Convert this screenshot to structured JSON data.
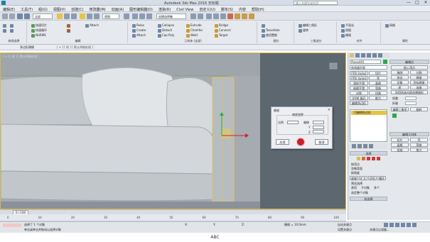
{
  "window": {
    "title": "Autodesk 3ds Max 2016    无标题",
    "search_placeholder": "键入关键字或短语",
    "minimize": "—",
    "maximize": "□",
    "close": "✕"
  },
  "menubar": {
    "items": [
      "编辑(E)",
      "工具(T)",
      "组(G)",
      "视图(V)",
      "创建(C)",
      "修改器(M)",
      "动画(A)",
      "图形编辑器(D)",
      "渲染(R)",
      "Civil View",
      "自定义(U)",
      "脚本(S)",
      "内容",
      "帮助(H)"
    ]
  },
  "toolbar": {
    "selection_filter": "全部",
    "coord_system": "视图",
    "selection_set": "创建选择集"
  },
  "ribbon": {
    "group_labels": [
      "修改选择",
      "编辑",
      "几何体 (全部)",
      "细分",
      "三角剖分",
      "对齐",
      "属性"
    ],
    "items_edit": [
      "快速切片",
      "快速循环",
      "NURMS",
      "Attach"
    ],
    "items_geometry": [
      "Relax",
      "Create",
      "Attach",
      "Collapse",
      "Detach",
      "Cap Poly",
      "Extrude",
      "Chamfer",
      "Weld",
      "Bridge",
      "Connect",
      "Target"
    ],
    "items_tessellate": [
      "Tessellate",
      "使用置换"
    ],
    "items_right": [
      "编辑三角形",
      "旋转",
      "网格",
      "平面化",
      "视图",
      "栅格"
    ]
  },
  "subbar": {
    "label": "多边形建模",
    "mode": "[ + ] [ 前 ] [ 默认明暗处理 ]"
  },
  "viewport": {
    "label": "[ + ] [ 前 ] [ 默认明暗处理 ]"
  },
  "dialog": {
    "title": "缩放",
    "group_label": "缩放变换",
    "fields": [
      {
        "label": "比例",
        "value": ""
      },
      {
        "label": "偏移",
        "value": ""
      },
      {
        "label": "Y",
        "value": ""
      },
      {
        "label": "Z",
        "value": ""
      }
    ],
    "buttons": {
      "ok": "应用",
      "cancel": "取消"
    }
  },
  "command_panel": {
    "object_name": "Plane001",
    "modifier_list": "修改器列表",
    "left_buttons": [
      "FFD 2x2x2",
      "FFD 3x3x3",
      "涡轮平滑",
      "网格平滑",
      "对称",
      "UVW 展开",
      "编辑多边形"
    ],
    "right_buttons": [
      "切片",
      "壳",
      "晶格",
      "弯曲",
      "扭曲",
      "推力"
    ],
    "stack_item": "可编辑多边形",
    "sections": [
      "选择",
      "软选择",
      "编辑几何体"
    ],
    "labels": [
      "按顶点",
      "忽略背面",
      "按角度",
      "收缩",
      "扩大",
      "环形",
      "循环",
      "预览选择",
      "禁用",
      "子对象",
      "多个",
      "选定整个对象",
      "软选择",
      "编辑边",
      "插入顶点",
      "移除",
      "分割",
      "挤出",
      "焊接",
      "切角",
      "目标焊接",
      "桥",
      "连接",
      "利用所选内容创建图形",
      "权重",
      "折缝",
      "编辑三角形",
      "旋转"
    ],
    "object_color": "#2ea84a"
  },
  "timeline": {
    "frame": "0 / 100",
    "ticks": [
      "0",
      "10",
      "20",
      "30",
      "40",
      "50",
      "60",
      "70",
      "80",
      "90",
      "100"
    ]
  },
  "status": {
    "selected": "选择了 1 个对象",
    "prompt": "单击或单击并拖动以选择对象",
    "x": "X:",
    "y": "Y:",
    "z": "Z:",
    "grid": "栅格 = 10.0mm",
    "autokey": "自动关键点",
    "setkey": "设置关键点",
    "filters": "关键点过滤器..."
  },
  "caption": "ABC"
}
